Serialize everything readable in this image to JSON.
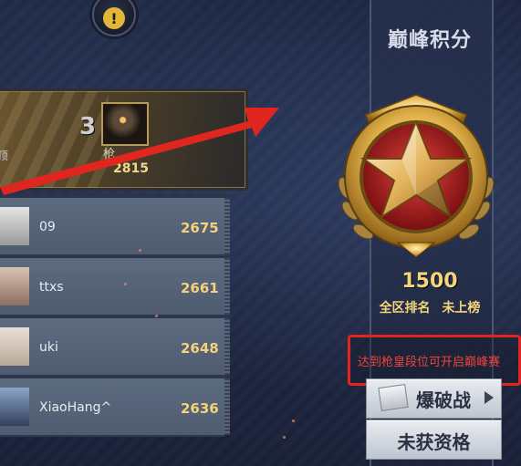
{
  "warning": {
    "glyph": "!"
  },
  "leaderboard": {
    "top": {
      "rank": "3",
      "name": "枪",
      "score": "2815",
      "left_label": "顶"
    },
    "rows": [
      {
        "name": "09",
        "score": "2675"
      },
      {
        "name": "ttxs",
        "score": "2661"
      },
      {
        "name": "uki",
        "score": "2648"
      },
      {
        "name": "XiaoHang^",
        "score": "2636"
      }
    ]
  },
  "panel": {
    "title": "巅峰积分",
    "points": "1500",
    "rank_label": "全区排名",
    "rank_value": "未上榜",
    "notice": "达到枪皇段位可开启巅峰赛"
  },
  "buttons": {
    "mode_label": "爆破战",
    "qualification_label": "未获资格"
  },
  "colors": {
    "accent_gold": "#f5d57c",
    "highlight_red": "#e0261e"
  }
}
